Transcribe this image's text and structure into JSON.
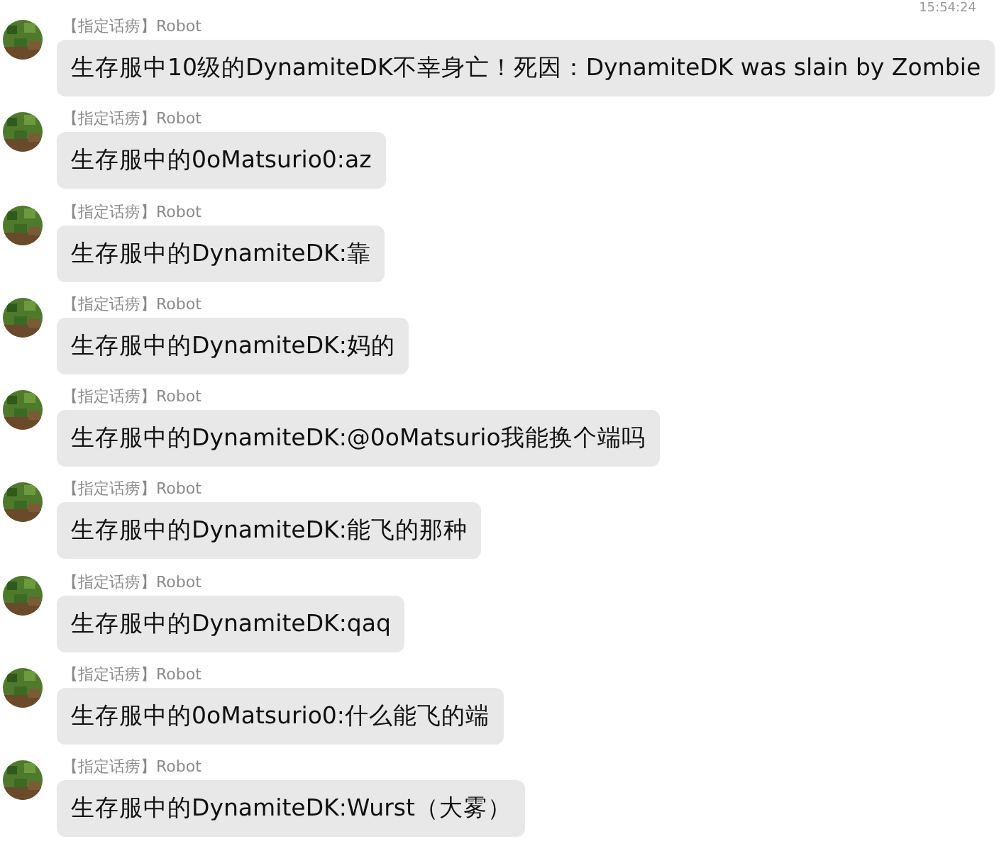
{
  "timestamp": "15:54:24",
  "messages": [
    {
      "sender": "【指定话痨】Robot",
      "text": "生存服中10级的DynamiteDK不幸身亡！死因：DynamiteDK was slain by Zombie"
    },
    {
      "sender": "【指定话痨】Robot",
      "text": "生存服中的0oMatsurio0:az"
    },
    {
      "sender": "【指定话痨】Robot",
      "text": "生存服中的DynamiteDK:靠"
    },
    {
      "sender": "【指定话痨】Robot",
      "text": "生存服中的DynamiteDK:妈的"
    },
    {
      "sender": "【指定话痨】Robot",
      "text": "生存服中的DynamiteDK:@0oMatsurio我能换个端吗"
    },
    {
      "sender": "【指定话痨】Robot",
      "text": "生存服中的DynamiteDK:能飞的那种"
    },
    {
      "sender": "【指定话痨】Robot",
      "text": "生存服中的DynamiteDK:qaq"
    },
    {
      "sender": "【指定话痨】Robot",
      "text": "生存服中的0oMatsurio0:什么能飞的端"
    },
    {
      "sender": "【指定话痨】Robot",
      "text": "生存服中的DynamiteDK:Wurst（大雾）"
    }
  ]
}
